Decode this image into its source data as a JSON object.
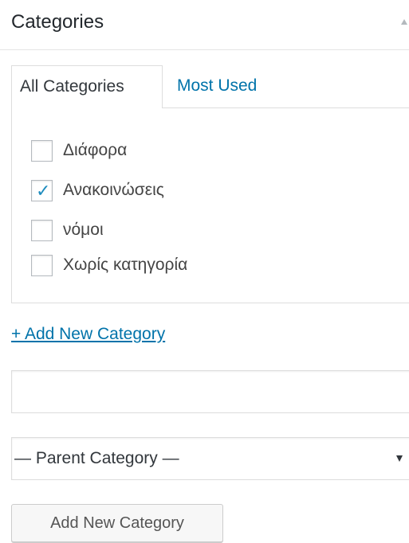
{
  "panel": {
    "title": "Categories"
  },
  "tabs": {
    "all_label": "All Categories",
    "most_used_label": "Most Used"
  },
  "categories": [
    {
      "label": "Διάφορα",
      "checked": false
    },
    {
      "label": "Ανακοινώσεις",
      "checked": true
    },
    {
      "label": "νόμοι",
      "checked": false
    },
    {
      "label": "Χωρίς κατηγορία",
      "checked": false
    }
  ],
  "add_new": {
    "link_label": "+ Add New Category",
    "name_value": "",
    "parent_selected": "— Parent Category —",
    "button_label": "Add New Category"
  },
  "icons": {
    "toggle": "collapse-arrow-icon",
    "checkmark": "checkmark-icon",
    "dropdown": "chevron-down-icon"
  },
  "colors": {
    "link": "#0073aa",
    "check": "#1e8cbe",
    "border": "#dddddd"
  }
}
